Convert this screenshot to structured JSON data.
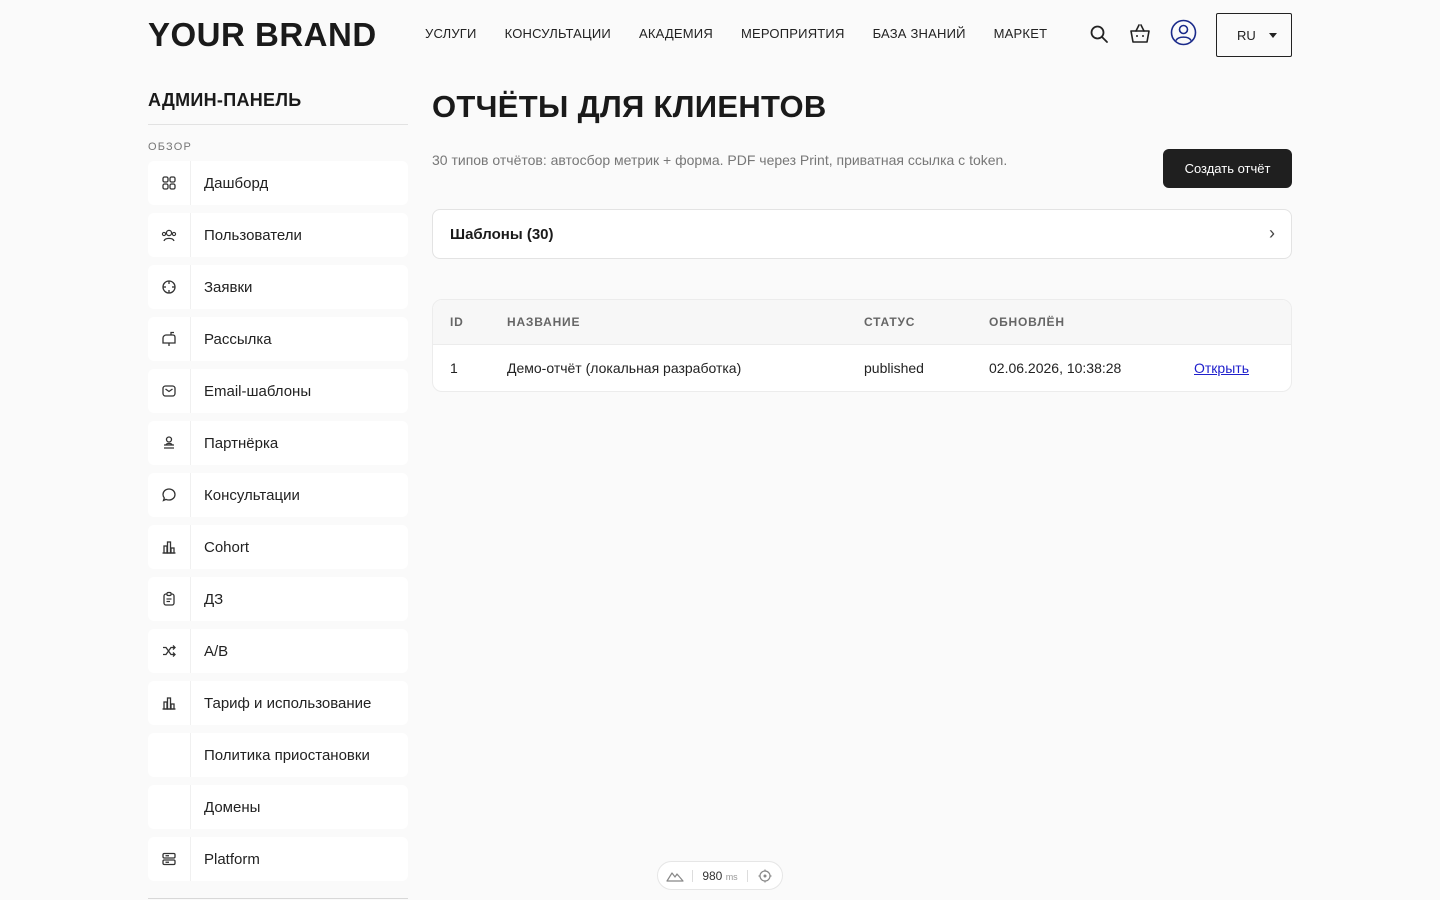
{
  "header": {
    "brand": "YOUR BRAND",
    "nav": [
      "УСЛУГИ",
      "КОНСУЛЬТАЦИИ",
      "АКАДЕМИЯ",
      "МЕРОПРИЯТИЯ",
      "БАЗА ЗНАНИЙ",
      "МАРКЕТ"
    ],
    "icons": [
      "search-icon",
      "cart-icon",
      "user-icon"
    ],
    "language": "RU"
  },
  "sidebar": {
    "title": "АДМИН-ПАНЕЛЬ",
    "section": "ОБЗОР",
    "items": [
      {
        "label": "Дашборд",
        "icon": "grid-icon"
      },
      {
        "label": "Пользователи",
        "icon": "users-icon"
      },
      {
        "label": "Заявки",
        "icon": "target-icon"
      },
      {
        "label": "Рассылка",
        "icon": "mailbox-icon"
      },
      {
        "label": "Email-шаблоны",
        "icon": "envelope-icon"
      },
      {
        "label": "Партнёрка",
        "icon": "partner-icon"
      },
      {
        "label": "Консультации",
        "icon": "chat-bubble-icon"
      },
      {
        "label": "Cohort",
        "icon": "bar-chart-icon"
      },
      {
        "label": "ДЗ",
        "icon": "clipboard-icon"
      },
      {
        "label": "A/B",
        "icon": "shuffle-icon"
      },
      {
        "label": "Тариф и использование",
        "icon": "bar-chart-icon"
      },
      {
        "label": "Политика приостановки",
        "icon": ""
      },
      {
        "label": "Домены",
        "icon": ""
      },
      {
        "label": "Platform",
        "icon": "server-icon"
      }
    ]
  },
  "main": {
    "title": "ОТЧЁТЫ ДЛЯ КЛИЕНТОВ",
    "description": "30 типов отчётов: автосбор метрик + форма. PDF через Print, приватная ссылка с token.",
    "create_button": "Создать отчёт",
    "templates_label": "Шаблоны (30)",
    "table": {
      "columns": [
        "ID",
        "НАЗВАНИЕ",
        "СТАТУС",
        "ОБНОВЛЁН"
      ],
      "rows": [
        {
          "id": "1",
          "name": "Демо-отчёт (локальная разработка)",
          "status": "published",
          "updated": "02.06.2026, 10:38:28",
          "action": "Открыть"
        }
      ]
    }
  },
  "perf": {
    "value": "980",
    "unit": "ms"
  },
  "colors": {
    "background": "#fafafa",
    "primary_button": "#1f1f1f",
    "link": "#1f1fcc",
    "muted_text": "#777777"
  }
}
